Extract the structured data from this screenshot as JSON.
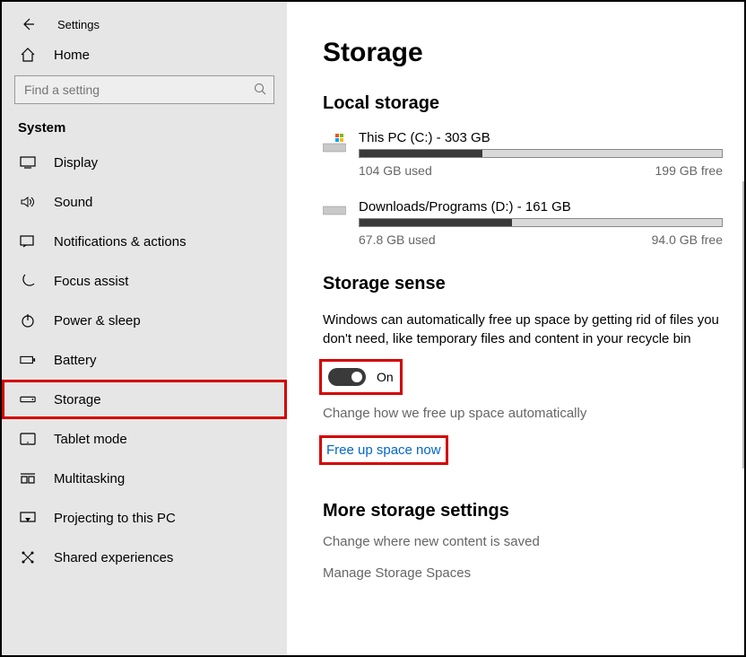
{
  "window_title": "Settings",
  "home_label": "Home",
  "search_placeholder": "Find a setting",
  "category": "System",
  "nav": [
    {
      "label": "Display"
    },
    {
      "label": "Sound"
    },
    {
      "label": "Notifications & actions"
    },
    {
      "label": "Focus assist"
    },
    {
      "label": "Power & sleep"
    },
    {
      "label": "Battery"
    },
    {
      "label": "Storage"
    },
    {
      "label": "Tablet mode"
    },
    {
      "label": "Multitasking"
    },
    {
      "label": "Projecting to this PC"
    },
    {
      "label": "Shared experiences"
    }
  ],
  "page": {
    "title": "Storage",
    "local_title": "Local storage",
    "drives": [
      {
        "name": "This PC (C:) - 303 GB",
        "used": "104 GB used",
        "free": "199 GB free",
        "pct": 34
      },
      {
        "name": "Downloads/Programs (D:) - 161 GB",
        "used": "67.8 GB used",
        "free": "94.0 GB free",
        "pct": 42
      }
    ],
    "sense_title": "Storage sense",
    "sense_desc": "Windows can automatically free up space by getting rid of files you don't need, like temporary files and content in your recycle bin",
    "toggle_label": "On",
    "change_link": "Change how we free up space automatically",
    "free_now": "Free up space now",
    "more_title": "More storage settings",
    "more1": "Change where new content is saved",
    "more2": "Manage Storage Spaces"
  }
}
